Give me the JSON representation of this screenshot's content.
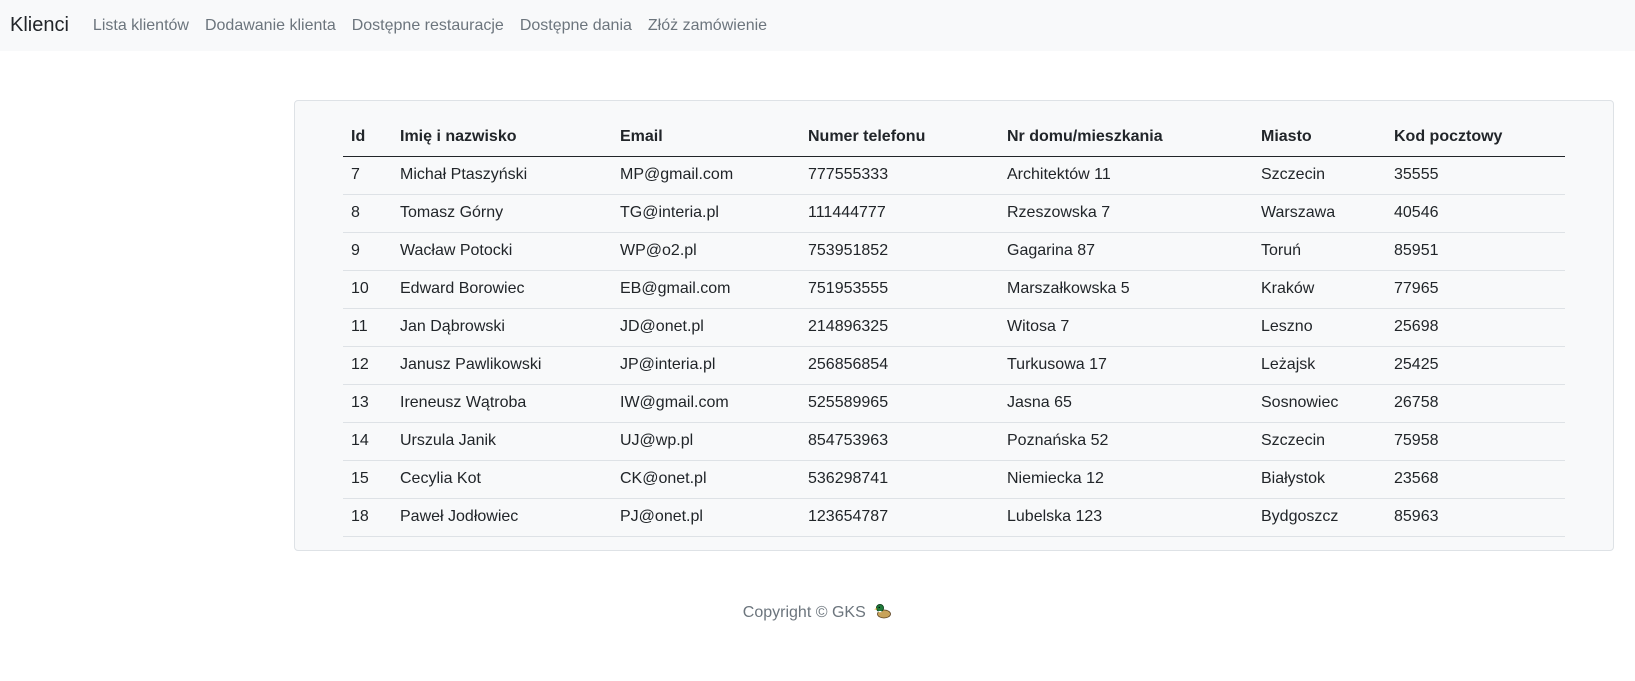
{
  "navbar": {
    "brand": "Klienci",
    "links": [
      "Lista klientów",
      "Dodawanie klienta",
      "Dostępne restauracje",
      "Dostępne dania",
      "Złóż zamówienie"
    ]
  },
  "table": {
    "headers": [
      "Id",
      "Imię i nazwisko",
      "Email",
      "Numer telefonu",
      "Nr domu/mieszkania",
      "Miasto",
      "Kod pocztowy"
    ],
    "rows": [
      [
        "7",
        "Michał Ptaszyński",
        "MP@gmail.com",
        "777555333",
        "Architektów 11",
        "Szczecin",
        "35555"
      ],
      [
        "8",
        "Tomasz Górny",
        "TG@interia.pl",
        "111444777",
        "Rzeszowska 7",
        "Warszawa",
        "40546"
      ],
      [
        "9",
        "Wacław Potocki",
        "WP@o2.pl",
        "753951852",
        "Gagarina 87",
        "Toruń",
        "85951"
      ],
      [
        "10",
        "Edward Borowiec",
        "EB@gmail.com",
        "751953555",
        "Marszałkowska 5",
        "Kraków",
        "77965"
      ],
      [
        "11",
        "Jan Dąbrowski",
        "JD@onet.pl",
        "214896325",
        "Witosa 7",
        "Leszno",
        "25698"
      ],
      [
        "12",
        "Janusz Pawlikowski",
        "JP@interia.pl",
        "256856854",
        "Turkusowa 17",
        "Leżajsk",
        "25425"
      ],
      [
        "13",
        "Ireneusz Wątroba",
        "IW@gmail.com",
        "525589965",
        "Jasna 65",
        "Sosnowiec",
        "26758"
      ],
      [
        "14",
        "Urszula Janik",
        "UJ@wp.pl",
        "854753963",
        "Poznańska 52",
        "Szczecin",
        "75958"
      ],
      [
        "15",
        "Cecylia Kot",
        "CK@onet.pl",
        "536298741",
        "Niemiecka 12",
        "Białystok",
        "23568"
      ],
      [
        "18",
        "Paweł Jodłowiec",
        "PJ@onet.pl",
        "123654787",
        "Lubelska 123",
        "Bydgoszcz",
        "85963"
      ]
    ]
  },
  "footer": {
    "text": "Copyright © GKS",
    "icon": "duck-icon"
  }
}
